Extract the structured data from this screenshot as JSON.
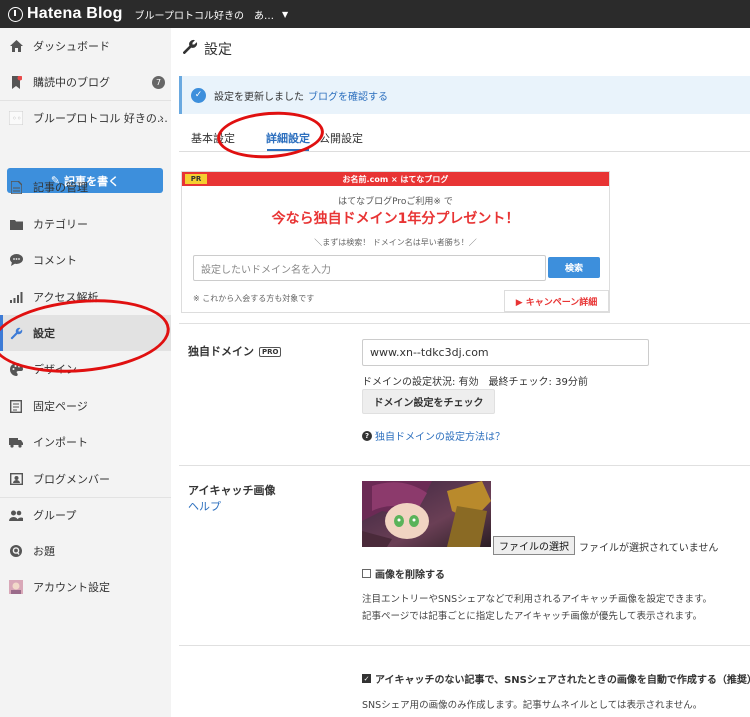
{
  "topbar": {
    "logo": "Hatena Blog",
    "blog_name": "ブループロトコル好きの　あ…"
  },
  "sidebar": {
    "items": [
      {
        "label": "ダッシュボード"
      },
      {
        "label": "購読中のブログ",
        "badge": "7"
      },
      {
        "label": "ブループロトコル 好きの…"
      },
      {
        "label": "記事の管理"
      },
      {
        "label": "カテゴリー"
      },
      {
        "label": "コメント"
      },
      {
        "label": "アクセス解析"
      },
      {
        "label": "設定"
      },
      {
        "label": "デザイン"
      },
      {
        "label": "固定ページ"
      },
      {
        "label": "インポート"
      },
      {
        "label": "ブログメンバー"
      },
      {
        "label": "グループ"
      },
      {
        "label": "お題"
      },
      {
        "label": "アカウント設定"
      }
    ],
    "write_button": "記事を書く"
  },
  "main": {
    "title": "設定",
    "alert": {
      "text": "設定を更新しました",
      "link": "ブログを確認する"
    },
    "tabs": [
      {
        "label": "基本設定"
      },
      {
        "label": "詳細設定"
      },
      {
        "label": "公開設定"
      }
    ],
    "banner": {
      "pr": "PR",
      "head": "お名前.com × はてなブログ",
      "line1": "はてなブログProご利用※ で",
      "line2": "今なら独自ドメイン1年分プレゼント！",
      "line3": "＼まずは検索！ ドメイン名は早い者勝ち！／",
      "input_placeholder": "設定したいドメイン名を入力",
      "search": "検索",
      "note": "※ これから入会する方も対象です",
      "campaign": "▶ キャンペーン詳細"
    },
    "domain": {
      "label": "独自ドメイン",
      "pro": "PRO",
      "value": "www.xn--tdkc3dj.com",
      "status": "ドメインの設定状況: 有効　最終チェック: 39分前",
      "check_button": "ドメイン設定をチェック",
      "help": "独自ドメインの設定方法は？"
    },
    "eyecatch": {
      "label": "アイキャッチ画像",
      "help": "ヘルプ",
      "file_button": "ファイルの選択",
      "file_status": "ファイルが選択されていません",
      "delete_label": "画像を削除する",
      "desc1": "注目エントリーやSNSシェアなどで利用されるアイキャッチ画像を設定できます。",
      "desc2": "記事ページでは記事ごとに指定したアイキャッチ画像が優先して表示されます。",
      "auto_label": "アイキャッチのない記事で、SNSシェアされたときの画像を自動で作成する（推奨）",
      "auto_desc": "SNSシェア用の画像のみ作成します。記事サムネイルとしては表示されません。"
    }
  }
}
